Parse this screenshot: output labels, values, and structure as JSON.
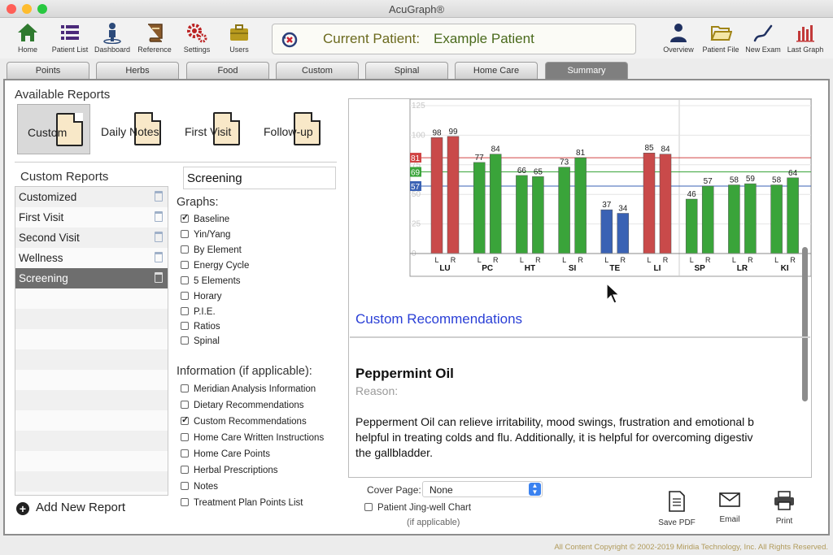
{
  "window": {
    "title": "AcuGraph®"
  },
  "toolbar": {
    "left": [
      {
        "label": "Home",
        "icon": "home-icon"
      },
      {
        "label": "Patient List",
        "icon": "list-icon"
      },
      {
        "label": "Dashboard",
        "icon": "dashboard-icon"
      },
      {
        "label": "Reference",
        "icon": "book-icon"
      },
      {
        "label": "Settings",
        "icon": "gears-icon"
      },
      {
        "label": "Users",
        "icon": "briefcase-icon"
      }
    ],
    "right": [
      {
        "label": "Overview",
        "icon": "person-icon"
      },
      {
        "label": "Patient File",
        "icon": "folder-icon"
      },
      {
        "label": "New Exam",
        "icon": "pen-icon"
      },
      {
        "label": "Last Graph",
        "icon": "bar-chart-icon"
      }
    ]
  },
  "patient": {
    "label": "Current Patient:",
    "name": "Example Patient"
  },
  "tabs": [
    "Points",
    "Herbs",
    "Food",
    "Custom",
    "Spinal",
    "Home Care",
    "Summary"
  ],
  "available_reports": {
    "heading": "Available Reports",
    "items": [
      "Custom",
      "Daily Notes",
      "First Visit",
      "Follow-up"
    ]
  },
  "custom_reports": {
    "heading": "Custom Reports",
    "items": [
      "Customized",
      "First Visit",
      "Second Visit",
      "Wellness",
      "Screening"
    ],
    "selected": "Screening",
    "add_label": "Add New Report"
  },
  "report_name": "Screening",
  "graphs": {
    "heading": "Graphs:",
    "items": [
      {
        "label": "Baseline",
        "checked": true
      },
      {
        "label": "Yin/Yang",
        "checked": false
      },
      {
        "label": "By Element",
        "checked": false
      },
      {
        "label": "Energy Cycle",
        "checked": false
      },
      {
        "label": "5 Elements",
        "checked": false
      },
      {
        "label": "Horary",
        "checked": false
      },
      {
        "label": "P.I.E.",
        "checked": false
      },
      {
        "label": "Ratios",
        "checked": false
      },
      {
        "label": "Spinal",
        "checked": false
      }
    ]
  },
  "information": {
    "heading": "Information (if applicable):",
    "items": [
      {
        "label": "Meridian Analysis Information",
        "checked": false
      },
      {
        "label": "Dietary Recommendations",
        "checked": false
      },
      {
        "label": "Custom Recommendations",
        "checked": true
      },
      {
        "label": "Home Care Written Instructions",
        "checked": false
      },
      {
        "label": "Home Care Points",
        "checked": false
      },
      {
        "label": "Herbal Prescriptions",
        "checked": false
      },
      {
        "label": "Notes",
        "checked": false
      },
      {
        "label": "Treatment Plan Points List",
        "checked": false
      }
    ]
  },
  "chart_data": {
    "type": "bar",
    "categories": [
      "LU",
      "PC",
      "HT",
      "SI",
      "TE",
      "LI",
      "SP",
      "LR",
      "KI"
    ],
    "sides": [
      "L",
      "R"
    ],
    "series": [
      {
        "values": [
          98,
          77,
          66,
          73,
          37,
          85,
          46,
          58,
          58
        ]
      },
      {
        "values": [
          99,
          84,
          65,
          81,
          34,
          84,
          57,
          59,
          64
        ]
      }
    ],
    "bar_colors": [
      "#c94a4a",
      "#3aa43a",
      "#3aa43a",
      "#3aa43a",
      "#3a62b4",
      "#c94a4a",
      "#3aa43a",
      "#3aa43a",
      "#3aa43a"
    ],
    "reference_lines": [
      {
        "value": 81,
        "color": "#d04444"
      },
      {
        "value": 69,
        "color": "#3aa43a"
      },
      {
        "value": 57,
        "color": "#3a62b4"
      }
    ],
    "yticks": [
      0,
      25,
      50,
      75,
      100,
      125
    ],
    "ylim": [
      0,
      125
    ]
  },
  "recommendations": {
    "heading": "Custom Recommendations",
    "title": "Peppermint Oil",
    "reason_label": "Reason:",
    "line1": "Pepperment Oil can relieve irritability, mood swings, frustration and emotional b",
    "line2": "helpful in treating colds and flu. Additionally, it is helpful for overcoming digestiv",
    "line3": "the gallbladder."
  },
  "cover_page": {
    "label": "Cover Page:",
    "value": "None"
  },
  "jingwell": {
    "label": "Patient Jing-well Chart",
    "note": "(if applicable)",
    "checked": false
  },
  "actions": [
    {
      "label": "Save PDF",
      "icon": "pdf-icon"
    },
    {
      "label": "Email",
      "icon": "email-icon"
    },
    {
      "label": "Print",
      "icon": "printer-icon"
    }
  ],
  "footer": "All Content Copyright © 2002-2019 Miridia Technology, Inc.  All Rights Reserved.",
  "colors": {
    "accent_blue": "#2a3fd6",
    "patient_label": "#6b6a1e",
    "patient_name": "#4a6a1c"
  }
}
